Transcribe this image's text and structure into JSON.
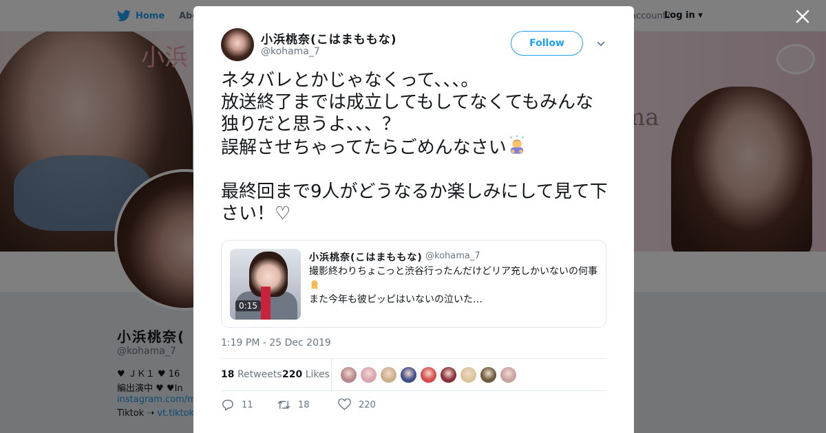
{
  "background": {
    "nav": {
      "home": "Home",
      "about": "Abo",
      "account_prompt": "account?",
      "login": "Log in"
    },
    "banner_deco_left": "小浜",
    "banner_deco_right": "ma",
    "profile": {
      "name": "小浜桃奈(",
      "handle": "@kohama_7",
      "bio1": "♥ ＪＫ１ ♥ 16",
      "bio2": "編出演中 ♥ ♥In",
      "link1": "instagram.com/m",
      "bio3_prefix": "Tiktok ➝ ",
      "bio3_link": "vt.tiktok."
    }
  },
  "tweet": {
    "author_name": "小浜桃奈(こはまももな)",
    "author_handle": "@kohama_7",
    "follow_label": "Follow",
    "text_line1": "ネタバレとかじゃなくって、、、。\n放送終了までは成立してもしてなくてもみんな独りだと思うよ、、、？\n誤解させちゃってたらごめんなさい",
    "text_line2": "\n\n最終回まで9人がどうなるか楽しみにして見て下さい！♡",
    "quoted": {
      "author_name": "小浜桃奈(こはまももな)",
      "author_handle": "@kohama_7",
      "duration": "0:15",
      "line1": "撮影終わりちょこっと渋谷行ったんだけどリア充しかいないの何事",
      "line2": "また今年も彼ピッピはいないの泣いた…"
    },
    "timestamp": "1:19 PM - 25 Dec 2019",
    "retweets_count": "18",
    "retweets_label": "Retweets",
    "likes_count": "220",
    "likes_label": "Likes",
    "liker_colors": [
      "#b9868c",
      "#d9a3b0",
      "#c8b08a",
      "#3f4d8a",
      "#d64b4b",
      "#8a2f3a",
      "#d9c39a",
      "#6b5a3b",
      "#c7a2a0"
    ],
    "actions": {
      "reply_count": "11",
      "retweet_count": "18",
      "like_count": "220"
    }
  },
  "colors": {
    "accent": "#1da1f2",
    "text": "#14171a",
    "muted": "#657786"
  }
}
